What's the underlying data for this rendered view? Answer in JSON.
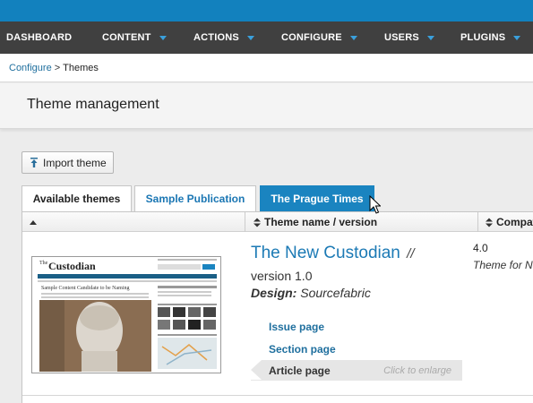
{
  "nav": {
    "items": [
      {
        "label": "DASHBOARD",
        "dropdown": false
      },
      {
        "label": "CONTENT",
        "dropdown": true
      },
      {
        "label": "ACTIONS",
        "dropdown": true
      },
      {
        "label": "CONFIGURE",
        "dropdown": true
      },
      {
        "label": "USERS",
        "dropdown": true
      },
      {
        "label": "PLUGINS",
        "dropdown": true
      }
    ]
  },
  "breadcrumb": {
    "parent": "Configure",
    "separator": ">",
    "current": "Themes"
  },
  "page": {
    "title": "Theme management"
  },
  "toolbar": {
    "import_label": "Import theme"
  },
  "tabs": [
    {
      "label": "Available themes",
      "state": "default"
    },
    {
      "label": "Sample Publication",
      "state": "link"
    },
    {
      "label": "The Prague Times",
      "state": "active"
    }
  ],
  "table": {
    "headers": {
      "name": "Theme name / version",
      "compat": "Compatib"
    }
  },
  "theme": {
    "name": "The New Custodian",
    "name_suffix": "//",
    "version": "version 1.0",
    "design_label": "Design:",
    "design_value": "Sourcefabric",
    "compat_version": "4.0",
    "compat_for": "Theme for N",
    "pages": [
      {
        "label": "Issue page"
      },
      {
        "label": "Section page"
      },
      {
        "label": "Article page",
        "active": true,
        "hint": "Click to enlarge"
      }
    ],
    "thumbnail": {
      "masthead_small": "The",
      "masthead": "Custodian",
      "headline": "Sample Content Candidate to be Naming"
    }
  },
  "colors": {
    "topbar": "#1281be",
    "nav": "#404040",
    "accent": "#1a84c0",
    "link": "#1c7ab5"
  }
}
